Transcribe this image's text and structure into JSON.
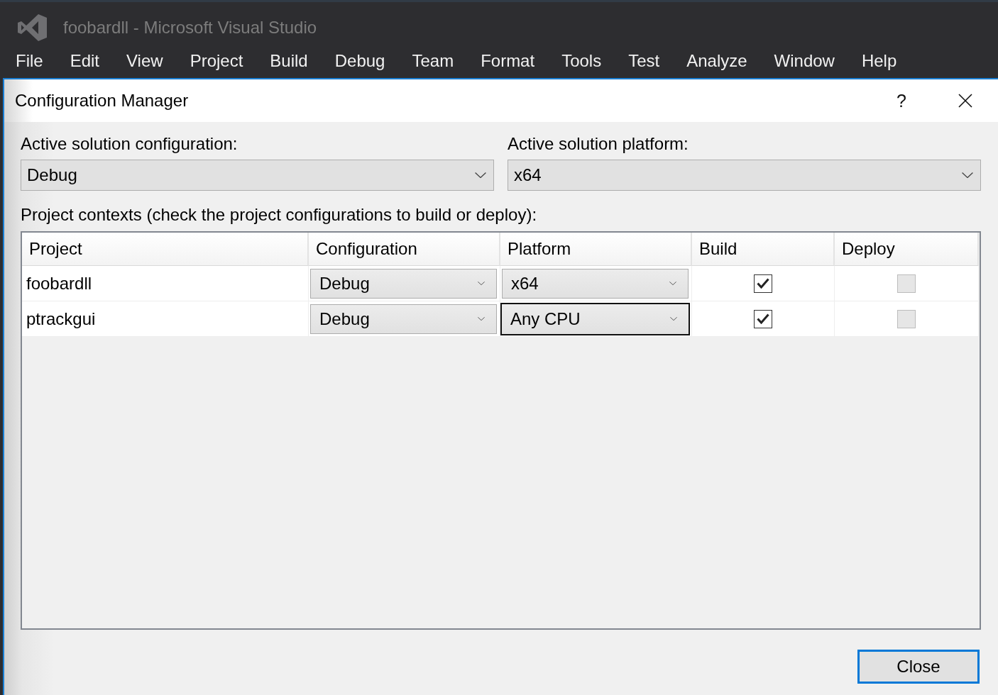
{
  "window": {
    "title": "foobardll - Microsoft Visual Studio"
  },
  "menu": [
    "File",
    "Edit",
    "View",
    "Project",
    "Build",
    "Debug",
    "Team",
    "Format",
    "Tools",
    "Test",
    "Analyze",
    "Window",
    "Help"
  ],
  "dialog": {
    "title": "Configuration Manager",
    "help": "?",
    "active_configuration": {
      "label": "Active solution configuration:",
      "value": "Debug"
    },
    "active_platform": {
      "label": "Active solution platform:",
      "value": "x64"
    },
    "contexts_label": "Project contexts (check the project configurations to build or deploy):",
    "grid": {
      "columns": [
        "Project",
        "Configuration",
        "Platform",
        "Build",
        "Deploy"
      ],
      "rows": [
        {
          "project": "foobardll",
          "configuration": {
            "value": "Debug",
            "focused": false
          },
          "platform": {
            "value": "x64",
            "focused": false
          },
          "build": {
            "checked": true,
            "disabled": false
          },
          "deploy": {
            "checked": false,
            "disabled": true
          }
        },
        {
          "project": "ptrackgui",
          "configuration": {
            "value": "Debug",
            "focused": false
          },
          "platform": {
            "value": "Any CPU",
            "focused": true
          },
          "build": {
            "checked": true,
            "disabled": false
          },
          "deploy": {
            "checked": false,
            "disabled": true
          }
        }
      ]
    },
    "close_button": {
      "label": "Close",
      "default": true
    }
  }
}
